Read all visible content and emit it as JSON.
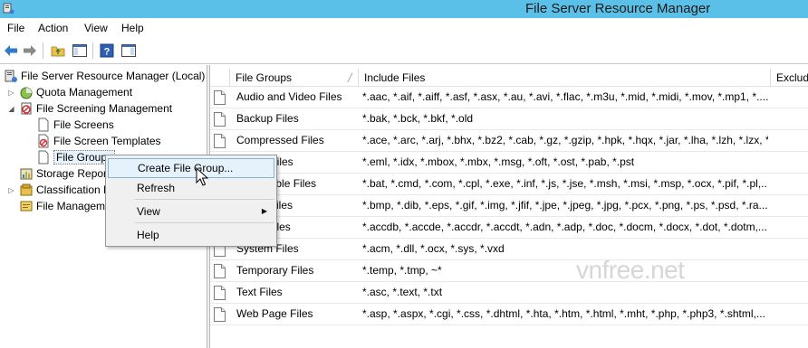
{
  "window": {
    "title": "File Server Resource Manager"
  },
  "menubar": {
    "items": [
      "File",
      "Action",
      "View",
      "Help"
    ]
  },
  "tree": {
    "root": "File Server Resource Manager (Local)",
    "quota": "Quota Management",
    "screening": "File Screening Management",
    "file_screens": "File Screens",
    "templates": "File Screen Templates",
    "file_groups": "File Groups",
    "storage_reports": "Storage Reports Management",
    "classification": "Classification Management",
    "file_management": "File Management Tasks"
  },
  "list": {
    "columns": [
      "File Groups",
      "Include Files",
      "Exclude Files"
    ],
    "rows": [
      {
        "name": "Audio and Video Files",
        "include": "*.aac, *.aif, *.aiff, *.asf, *.asx, *.au, *.avi, *.flac, *.m3u, *.mid, *.midi, *.mov, *.mp1, *...."
      },
      {
        "name": "Backup Files",
        "include": "*.bak, *.bck, *.bkf, *.old"
      },
      {
        "name": "Compressed Files",
        "include": "*.ace, *.arc, *.arj, *.bhx, *.bz2, *.cab, *.gz, *.gzip, *.hpk, *.hqx, *.jar, *.lha, *.lzh, *.lzx, *...."
      },
      {
        "name": "E-mail Files",
        "include": "*.eml, *.idx, *.mbox, *.mbx, *.msg, *.oft, *.ost, *.pab, *.pst"
      },
      {
        "name": "Executable Files",
        "include": "*.bat, *.cmd, *.com, *.cpl, *.exe, *.inf, *.js, *.jse, *.msh, *.msi, *.msp, *.ocx, *.pif, *.pl,..."
      },
      {
        "name": "Image Files",
        "include": "*.bmp, *.dib, *.eps, *.gif, *.img, *.jfif, *.jpe, *.jpeg, *.jpg, *.pcx, *.png, *.ps, *.psd, *.ra..."
      },
      {
        "name": "Office Files",
        "include": "*.accdb, *.accde, *.accdr, *.accdt, *.adn, *.adp, *.doc, *.docm, *.docx, *.dot, *.dotm,..."
      },
      {
        "name": "System Files",
        "include": "*.acm, *.dll, *.ocx, *.sys, *.vxd"
      },
      {
        "name": "Temporary Files",
        "include": "*.temp, *.tmp, ~*"
      },
      {
        "name": "Text Files",
        "include": "*.asc, *.text, *.txt"
      },
      {
        "name": "Web Page Files",
        "include": "*.asp, *.aspx, *.cgi, *.css, *.dhtml, *.hta, *.htm, *.html, *.mht, *.php, *.php3, *.shtml,..."
      }
    ]
  },
  "context_menu": {
    "create": "Create File Group...",
    "refresh": "Refresh",
    "view": "View",
    "help": "Help"
  },
  "watermark": "vnfree.net",
  "colors": {
    "titlebar": "#5bc0e8",
    "selection": "#e5f1fb",
    "hover_border": "#7fb4e0"
  }
}
